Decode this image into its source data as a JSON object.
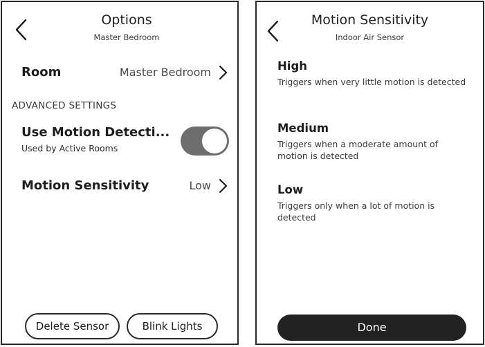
{
  "options_screen": {
    "title": "Options",
    "subtitle": "Master Bedroom",
    "room": {
      "label": "Room",
      "value": "Master Bedroom"
    },
    "advanced_heading": "ADVANCED SETTINGS",
    "motion_detection": {
      "label": "Use Motion Detecti...",
      "sublabel": "Used by Active Rooms",
      "toggle_on": true
    },
    "motion_sensitivity": {
      "label": "Motion Sensitivity",
      "value": "Low"
    },
    "buttons": {
      "delete_sensor": "Delete Sensor",
      "blink_lights": "Blink Lights"
    }
  },
  "sensitivity_screen": {
    "title": "Motion Sensitivity",
    "subtitle": "Indoor Air Sensor",
    "options": [
      {
        "title": "High",
        "description": "Triggers when very little motion is detected"
      },
      {
        "title": "Medium",
        "description": "Triggers when a moderate amount of motion is detected"
      },
      {
        "title": "Low",
        "description": "Triggers only when a lot of motion is detected"
      }
    ],
    "done_label": "Done"
  },
  "icons": {
    "back": "chevron-left-icon",
    "forward": "chevron-right-icon"
  },
  "colors": {
    "toggle_track": "#6e6e6e",
    "done_button": "#222222",
    "text_primary": "#1e1e1e",
    "text_secondary": "#4a4a4a"
  }
}
